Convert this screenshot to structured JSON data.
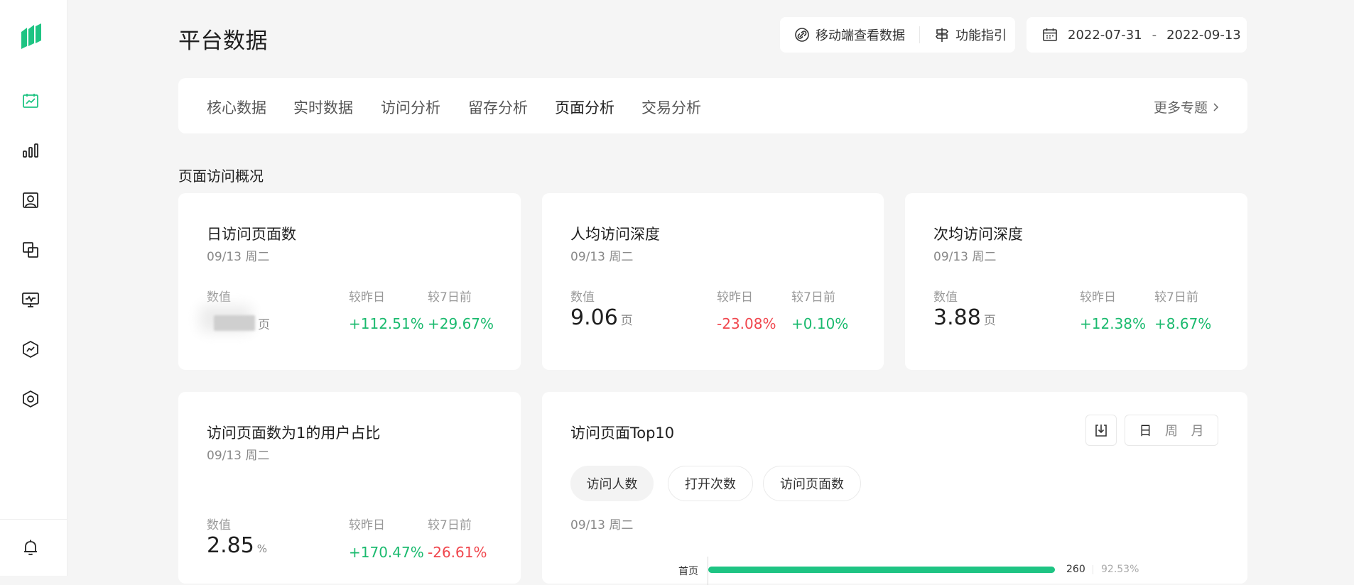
{
  "sidebar": {
    "items": [
      {
        "name": "dashboard",
        "active": true
      },
      {
        "name": "bar-chart"
      },
      {
        "name": "user-profile"
      },
      {
        "name": "layers"
      },
      {
        "name": "monitor"
      },
      {
        "name": "trend-hexagon"
      },
      {
        "name": "settings-hexagon"
      }
    ],
    "bottom": "bell"
  },
  "header": {
    "title": "平台数据",
    "mobile_view": "移动端查看数据",
    "guide": "功能指引",
    "date_start": "2022-07-31",
    "date_sep": "-",
    "date_end": "2022-09-13"
  },
  "tabs": {
    "items": [
      "核心数据",
      "实时数据",
      "访问分析",
      "留存分析",
      "页面分析",
      "交易分析"
    ],
    "active_index": 4,
    "more": "更多专题"
  },
  "section_title": "页面访问概况",
  "labels": {
    "value": "数值",
    "vs_yesterday": "较昨日",
    "vs_7days": "较7日前"
  },
  "cards": [
    {
      "title": "日访问页面数",
      "date": "09/13 周二",
      "value": "",
      "unit": "页",
      "change_day": "+112.51%",
      "change_week": "+29.67%"
    },
    {
      "title": "人均访问深度",
      "date": "09/13 周二",
      "value": "9.06",
      "unit": "页",
      "change_day": "-23.08%",
      "change_week": "+0.10%"
    },
    {
      "title": "次均访问深度",
      "date": "09/13 周二",
      "value": "3.88",
      "unit": "页",
      "change_day": "+12.38%",
      "change_week": "+8.67%"
    },
    {
      "title": "访问页面数为1的用户占比",
      "date": "09/13 周二",
      "value": "2.85",
      "unit": "%",
      "change_day": "+170.47%",
      "change_week": "-26.61%"
    }
  ],
  "top10": {
    "title": "访问页面Top10",
    "periods": [
      "日",
      "周",
      "月"
    ],
    "active_period": 0,
    "metrics": [
      "访问人数",
      "打开次数",
      "访问页面数"
    ],
    "active_metric": 0,
    "date": "09/13 周二",
    "rows": [
      {
        "label": "首页",
        "count": "260",
        "pct": "92.53%",
        "ratio": 0.9253
      }
    ]
  },
  "colors": {
    "accent": "#1ec483",
    "up": "#1aba6e",
    "down": "#f0464d"
  }
}
